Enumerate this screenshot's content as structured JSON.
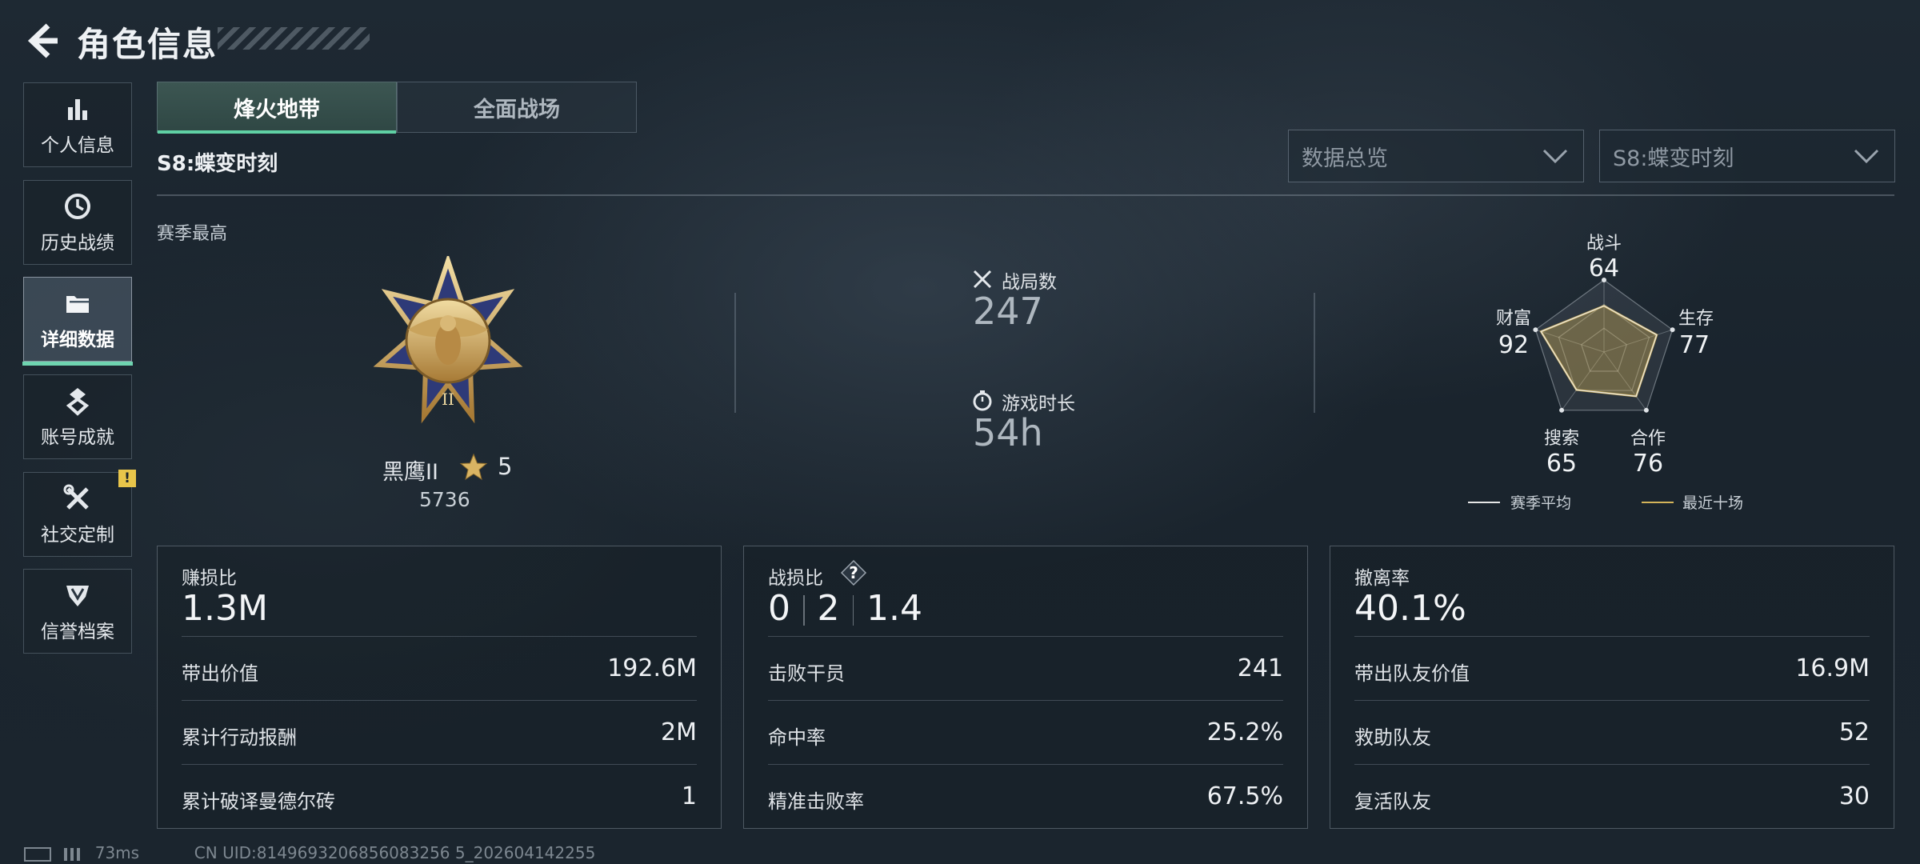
{
  "header": {
    "title": "角色信息"
  },
  "sidebar": {
    "items": [
      {
        "label": "个人信息",
        "icon": "bar-chart-icon"
      },
      {
        "label": "历史战绩",
        "icon": "history-clock-icon"
      },
      {
        "label": "详细数据",
        "icon": "folder-icon",
        "active": true
      },
      {
        "label": "账号成就",
        "icon": "achievement-medal-icon"
      },
      {
        "label": "社交定制",
        "icon": "tools-icon",
        "badge": "!"
      },
      {
        "label": "信誉档案",
        "icon": "reputation-shield-icon"
      }
    ]
  },
  "tabs": [
    {
      "label": "烽火地带",
      "active": true
    },
    {
      "label": "全面战场",
      "active": false
    }
  ],
  "season_title": "S8:蝶变时刻",
  "dropdowns": {
    "data_overview": {
      "value": "数据总览"
    },
    "season": {
      "value": "S8:蝶变时刻"
    }
  },
  "overview": {
    "season_best_label": "赛季最高",
    "rank": {
      "name": "黑鹰II",
      "stars": "5",
      "score": "5736"
    },
    "matches": {
      "label": "战局数",
      "value": "247"
    },
    "playtime": {
      "label": "游戏时长",
      "value": "54h"
    }
  },
  "radar": {
    "axes": [
      {
        "label": "战斗",
        "value": "64"
      },
      {
        "label": "生存",
        "value": "77"
      },
      {
        "label": "合作",
        "value": "76"
      },
      {
        "label": "搜索",
        "value": "65"
      },
      {
        "label": "财富",
        "value": "92"
      }
    ],
    "legend": {
      "season_avg": "赛季平均",
      "recent_ten": "最近十场"
    },
    "colors": {
      "season_avg": "#e6e6e6",
      "recent_ten": "#d4b45a"
    }
  },
  "panels": {
    "profit": {
      "title": "赚损比",
      "big": "1.3M",
      "rows": [
        {
          "label": "带出价值",
          "value": "192.6M"
        },
        {
          "label": "累计行动报酬",
          "value": "2M"
        },
        {
          "label": "累计破译曼德尔砖",
          "value": "1"
        }
      ]
    },
    "kd": {
      "title": "战损比",
      "kills": "0",
      "deaths": "2",
      "ratio": "1.4",
      "rows": [
        {
          "label": "击败干员",
          "value": "241"
        },
        {
          "label": "命中率",
          "value": "25.2%"
        },
        {
          "label": "精准击败率",
          "value": "67.5%"
        }
      ]
    },
    "extract": {
      "title": "撤离率",
      "big": "40.1%",
      "rows": [
        {
          "label": "带出队友价值",
          "value": "16.9M"
        },
        {
          "label": "救助队友",
          "value": "52"
        },
        {
          "label": "复活队友",
          "value": "30"
        }
      ]
    }
  },
  "footer": {
    "ping": "73ms",
    "uid": "CN UID:8149693206856083256 5_202604142255"
  },
  "colors": {
    "accent": "#5fd0a4",
    "badge": "#e8c54a"
  }
}
